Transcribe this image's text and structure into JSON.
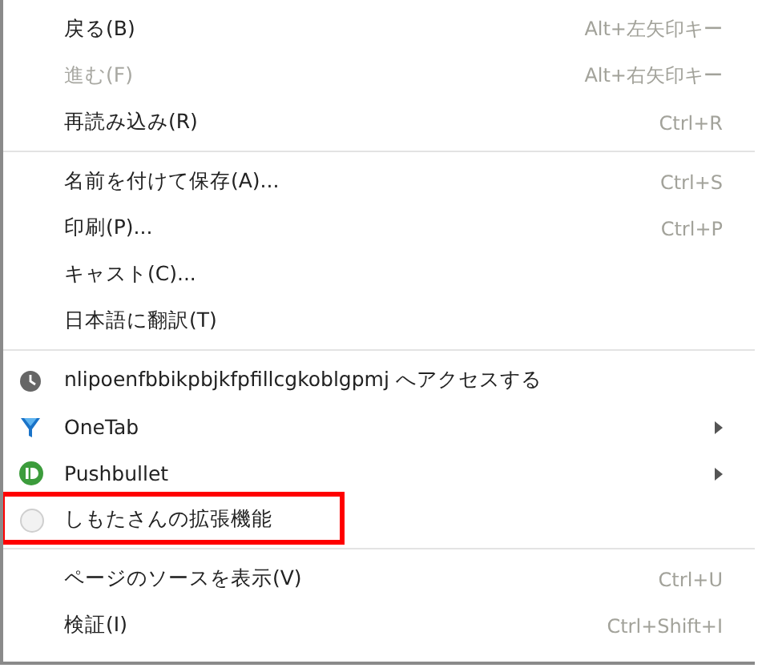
{
  "menu": {
    "sections": [
      {
        "items": [
          {
            "kind": "command",
            "label": "戻る(B)",
            "shortcut": "Alt+左矢印キー",
            "disabled": false
          },
          {
            "kind": "command",
            "label": "進む(F)",
            "shortcut": "Alt+右矢印キー",
            "disabled": true
          },
          {
            "kind": "command",
            "label": "再読み込み(R)",
            "shortcut": "Ctrl+R",
            "disabled": false
          }
        ]
      },
      {
        "items": [
          {
            "kind": "command",
            "label": "名前を付けて保存(A)...",
            "shortcut": "Ctrl+S",
            "disabled": false
          },
          {
            "kind": "command",
            "label": "印刷(P)...",
            "shortcut": "Ctrl+P",
            "disabled": false
          },
          {
            "kind": "command",
            "label": "キャスト(C)...",
            "disabled": false
          },
          {
            "kind": "command",
            "label": "日本語に翻訳(T)",
            "disabled": false
          }
        ]
      },
      {
        "items": [
          {
            "kind": "extension",
            "label": "nlipoenfbbikpbjkfpfillcgkoblgpmj へアクセスする",
            "submenu": false,
            "highlighted": false
          },
          {
            "kind": "extension",
            "label": "OneTab",
            "submenu": true,
            "highlighted": false
          },
          {
            "kind": "extension",
            "label": "Pushbullet",
            "submenu": true,
            "highlighted": false
          },
          {
            "kind": "extension",
            "label": "しもたさんの拡張機能",
            "submenu": false,
            "highlighted": true
          }
        ]
      },
      {
        "items": [
          {
            "kind": "command",
            "label": "ページのソースを表示(V)",
            "shortcut": "Ctrl+U",
            "disabled": false
          },
          {
            "kind": "command",
            "label": "検証(I)",
            "shortcut": "Ctrl+Shift+I",
            "disabled": false
          }
        ]
      }
    ]
  }
}
